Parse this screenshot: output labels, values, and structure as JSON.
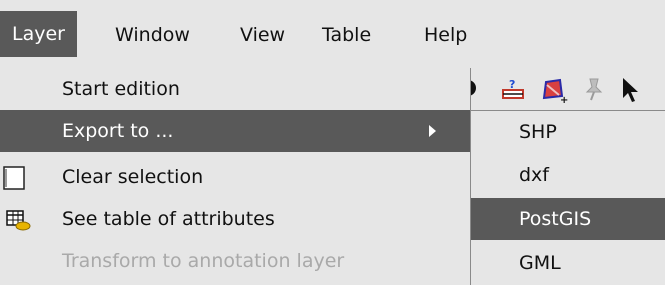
{
  "menubar": {
    "items": [
      {
        "label": "Layer",
        "active": true
      },
      {
        "label": "Window"
      },
      {
        "label": "View"
      },
      {
        "label": "Table"
      },
      {
        "label": "Help"
      }
    ]
  },
  "layer_menu": {
    "items": [
      {
        "label": "Start edition",
        "enabled": true
      },
      {
        "label": "Export to ...",
        "enabled": true,
        "highlighted": true,
        "has_submenu": true
      },
      {
        "label": "Clear selection",
        "enabled": true,
        "icon": "clear-selection-icon"
      },
      {
        "label": "See table of attributes",
        "enabled": true,
        "icon": "table-icon"
      },
      {
        "label": "Transform to annotation layer",
        "enabled": false
      }
    ]
  },
  "export_submenu": {
    "items": [
      {
        "label": "SHP"
      },
      {
        "label": "dxf"
      },
      {
        "label": "PostGIS",
        "highlighted": true
      },
      {
        "label": "GML"
      }
    ]
  },
  "toolbar": {
    "icons": [
      "tool-icon",
      "layer-edit-icon",
      "polygon-add-icon",
      "pin-icon",
      "pointer-icon"
    ]
  },
  "colors": {
    "highlight": "#595959",
    "background": "#e6e6e6",
    "disabled_text": "#a9a9a9"
  }
}
